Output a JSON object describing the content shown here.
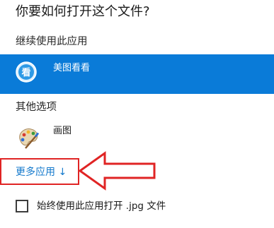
{
  "dialog": {
    "title": "你要如何打开这个文件?",
    "continue_section_label": "继续使用此应用",
    "selected_app": {
      "name": "美图看看",
      "icon": "meitu-kankan-icon"
    },
    "other_section_label": "其他选项",
    "other_apps": [
      {
        "name": "画图",
        "icon": "paint-palette-icon"
      }
    ],
    "more_apps_link": "更多应用 ↓",
    "always_use_label": "始终使用此应用打开 .jpg 文件",
    "always_use_checked": false
  },
  "annotation": {
    "type": "arrow",
    "color": "#e02424",
    "points_to": "more-apps-link"
  },
  "colors": {
    "selected_bg": "#0a7bd8",
    "link": "#1479cc",
    "annotation": "#e02424"
  }
}
